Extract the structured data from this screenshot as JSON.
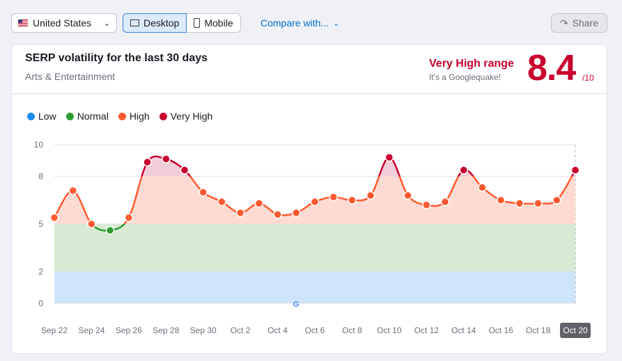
{
  "toolbar": {
    "country": "United States",
    "desktop": "Desktop",
    "mobile": "Mobile",
    "compare": "Compare with...",
    "share": "Share"
  },
  "card": {
    "title": "SERP volatility for the last 30 days",
    "subtitle": "Arts & Entertainment",
    "range_label": "Very High range",
    "range_sub": "It's a Googlequake!",
    "score": "8.4",
    "score_max": "/10"
  },
  "legend": [
    {
      "label": "Low",
      "color": "#1a8cf0"
    },
    {
      "label": "Normal",
      "color": "#2e9c2e"
    },
    {
      "label": "High",
      "color": "#ff5a30"
    },
    {
      "label": "Very High",
      "color": "#c8002d"
    }
  ],
  "chart_data": {
    "type": "line",
    "title": "SERP volatility",
    "ylim": [
      0,
      10
    ],
    "yticks": [
      "0",
      "2",
      "5",
      "8",
      "10"
    ],
    "x": [
      "Sep 22",
      "Sep 23",
      "Sep 24",
      "Sep 25",
      "Sep 26",
      "Sep 27",
      "Sep 28",
      "Sep 29",
      "Sep 30",
      "Oct 1",
      "Oct 2",
      "Oct 3",
      "Oct 4",
      "Oct 5",
      "Oct 6",
      "Oct 7",
      "Oct 8",
      "Oct 9",
      "Oct 10",
      "Oct 11",
      "Oct 12",
      "Oct 13",
      "Oct 14",
      "Oct 15",
      "Oct 16",
      "Oct 17",
      "Oct 18",
      "Oct 19",
      "Oct 20"
    ],
    "xticks": [
      "Sep 22",
      "Sep 24",
      "Sep 26",
      "Sep 28",
      "Sep 30",
      "Oct 2",
      "Oct 4",
      "Oct 6",
      "Oct 8",
      "Oct 10",
      "Oct 12",
      "Oct 14",
      "Oct 16",
      "Oct 18",
      "Oct 20"
    ],
    "values": [
      5.4,
      7.1,
      5.0,
      4.6,
      5.4,
      8.9,
      9.1,
      8.4,
      7.0,
      6.4,
      5.7,
      6.3,
      5.6,
      5.7,
      6.4,
      6.7,
      6.5,
      6.8,
      9.2,
      6.8,
      6.2,
      6.4,
      8.4,
      7.3,
      6.5,
      6.3,
      6.3,
      6.5,
      8.4
    ],
    "selected": "Oct 20"
  }
}
